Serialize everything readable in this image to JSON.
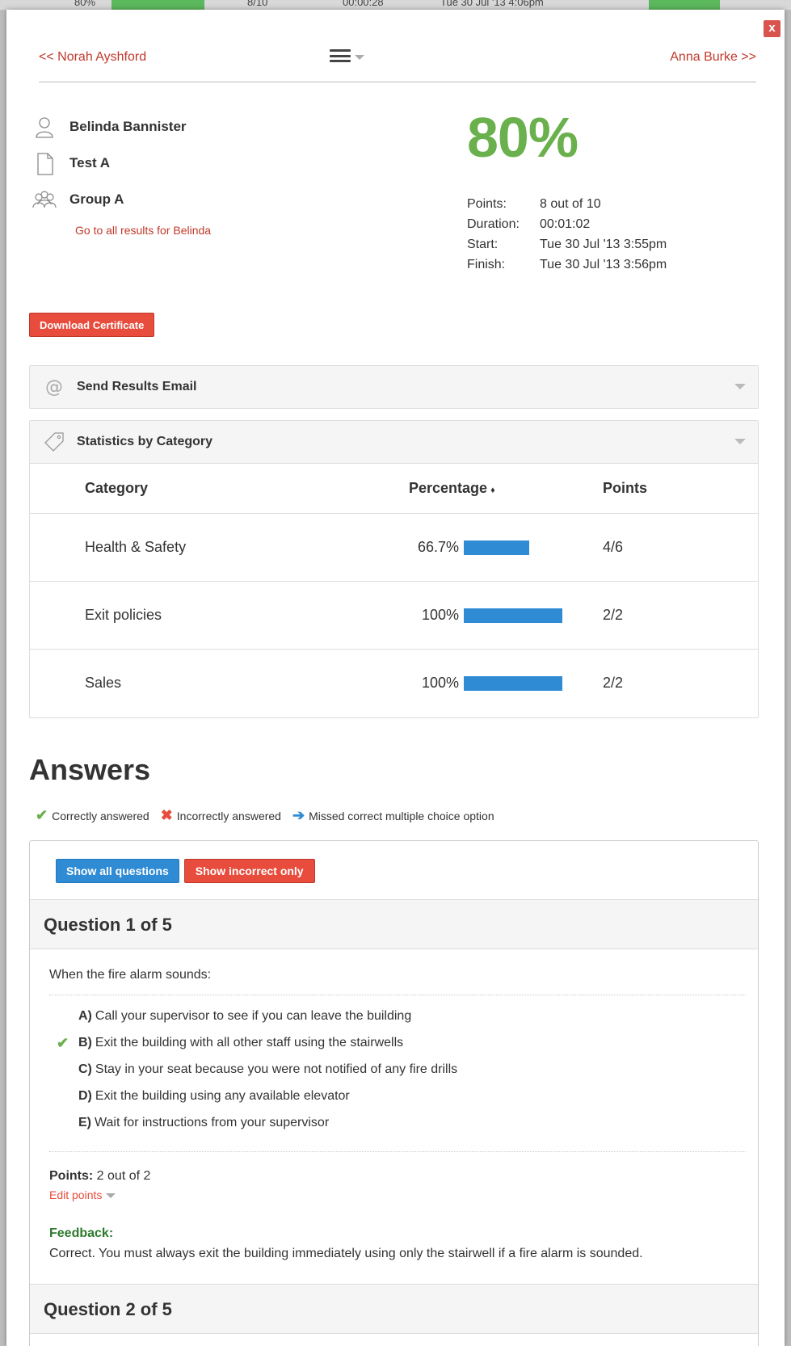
{
  "background_row": {
    "c1": "80%",
    "c2": "8/10",
    "c3": "00:00:28",
    "c4": "Tue 30 Jul '13 4:06pm"
  },
  "nav": {
    "prev": "<< Norah Ayshford",
    "next": "Anna Burke >>"
  },
  "close_label": "x",
  "result": {
    "user": "Belinda Bannister",
    "test": "Test A",
    "group": "Group A",
    "all_results_link": "Go to all results for Belinda",
    "score": "80%",
    "stats": [
      {
        "label": "Points:",
        "value": "8 out of 10"
      },
      {
        "label": "Duration:",
        "value": "00:01:02"
      },
      {
        "label": "Start:",
        "value": "Tue 30 Jul '13 3:55pm"
      },
      {
        "label": "Finish:",
        "value": "Tue 30 Jul '13 3:56pm"
      }
    ]
  },
  "certificate_button": "Download Certificate",
  "email_panel": {
    "title": "Send Results Email"
  },
  "category_panel": {
    "title": "Statistics by Category",
    "headers": {
      "category": "Category",
      "percentage": "Percentage",
      "points": "Points"
    },
    "rows": [
      {
        "category": "Health & Safety",
        "percent_label": "66.7%",
        "percent": 66.7,
        "points": "4/6"
      },
      {
        "category": "Exit policies",
        "percent_label": "100%",
        "percent": 100,
        "points": "2/2"
      },
      {
        "category": "Sales",
        "percent_label": "100%",
        "percent": 100,
        "points": "2/2"
      }
    ]
  },
  "answers": {
    "heading": "Answers",
    "legend": {
      "correct": "Correctly answered",
      "incorrect": "Incorrectly answered",
      "missed": "Missed correct multiple choice option"
    },
    "show_all": "Show all questions",
    "show_incorrect": "Show incorrect only",
    "questions": [
      {
        "title": "Question 1 of 5",
        "text": "When the fire alarm sounds:",
        "options": [
          {
            "letter": "A)",
            "text": "Call your supervisor to see if you can leave the building",
            "selected": false
          },
          {
            "letter": "B)",
            "text": "Exit the building with all other staff using the stairwells",
            "selected": true
          },
          {
            "letter": "C)",
            "text": "Stay in your seat because you were not notified of any fire drills",
            "selected": false
          },
          {
            "letter": "D)",
            "text": "Exit the building using any available elevator",
            "selected": false
          },
          {
            "letter": "E)",
            "text": "Wait for instructions from your supervisor",
            "selected": false
          }
        ],
        "points_label": "Points:",
        "points_value": "2 out of 2",
        "edit_points": "Edit points",
        "feedback_label": "Feedback:",
        "feedback_text": "Correct. You must always exit the building immediately using only the stairwell if a fire alarm is sounded."
      },
      {
        "title": "Question 2 of 5"
      }
    ]
  },
  "colors": {
    "score_green": "#6ab04c",
    "link_red": "#c0392b",
    "bar_blue": "#2e8bd4",
    "button_red": "#e74c3c"
  }
}
